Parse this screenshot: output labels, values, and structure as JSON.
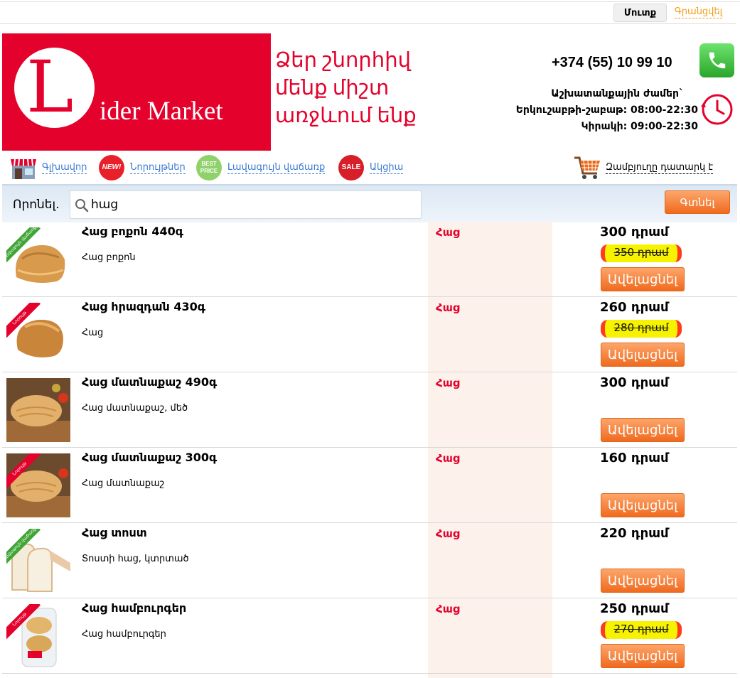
{
  "topbar": {
    "login_label": "Մուտք",
    "register_label": "Գրանցվել"
  },
  "brand": {
    "logo_letter": "L",
    "logo_text": "ider Market",
    "logo_color": "#e4022d",
    "slogan_lines": [
      "Ձեր շնորհիվ",
      "մենք միշտ",
      "առջևում ենք"
    ]
  },
  "contact": {
    "phone": "+374 (55) 10 99 10",
    "hours_title": "Աշխատանքային ժամեր`",
    "hours_weekdays": "Երկուշաբթի-շաբաթ: 08:00-22:30",
    "hours_sunday": "Կիրակի: 09:00-22:30"
  },
  "nav": {
    "items": [
      {
        "label": "Գլխավոր",
        "icon": "store-icon"
      },
      {
        "label": "Նորույթներ",
        "icon": "new-badge-icon",
        "badge": "NEW!",
        "badge_color": "#e8202a"
      },
      {
        "label": "Լավագույն վաճառք",
        "icon": "best-price-icon",
        "badge": "BEST PRICE",
        "badge_color": "#8fd16a"
      },
      {
        "label": "Ակցիա",
        "icon": "sale-icon",
        "badge": "SALE",
        "badge_color": "#d71f2a"
      }
    ],
    "cart_label": "Զամբյուղը դատարկ է"
  },
  "search": {
    "label": "Որոնել.",
    "query": "հաց",
    "button_label": "Գտնել"
  },
  "products": [
    {
      "name": "Հաց բոքոն 440գ",
      "desc": "Հաց բոքոն",
      "category": "Հաց",
      "price": "300 դրամ",
      "old_price": "350 դրամ",
      "ribbon": "Լավագույն վաճառք",
      "ribbon_color": "#3fa535",
      "add_label": "Ավելացնել"
    },
    {
      "name": "Հաց հրազդան 430գ",
      "desc": "Հաց",
      "category": "Հաց",
      "price": "260 դրամ",
      "old_price": "280 դրամ",
      "ribbon": "Նորույթ",
      "ribbon_color": "#e4022d",
      "add_label": "Ավելացնել"
    },
    {
      "name": "Հաց մատնաքաշ 490գ",
      "desc": "Հաց մատնաքաշ, մեծ",
      "category": "Հաց",
      "price": "300 դրամ",
      "old_price": "",
      "ribbon": "",
      "ribbon_color": "",
      "add_label": "Ավելացնել"
    },
    {
      "name": "Հաց մատնաքաշ 300գ",
      "desc": "Հաց մատնաքաշ",
      "category": "Հաց",
      "price": "160 դրամ",
      "old_price": "",
      "ribbon": "Նորույթ",
      "ribbon_color": "#e4022d",
      "add_label": "Ավելացնել"
    },
    {
      "name": "Հաց տոստ",
      "desc": "Տոստի հաց, կտրտած",
      "category": "Հաց",
      "price": "220 դրամ",
      "old_price": "",
      "ribbon": "Լավագույն վաճառք",
      "ribbon_color": "#3fa535",
      "add_label": "Ավելացնել"
    },
    {
      "name": "Հաց համբուրգեր",
      "desc": "Հաց համբուրգեր",
      "category": "Հաց",
      "price": "250 դրամ",
      "old_price": "270 դրամ",
      "ribbon": "Նորույթ",
      "ribbon_color": "#e4022d",
      "add_label": "Ավելացնել"
    }
  ]
}
